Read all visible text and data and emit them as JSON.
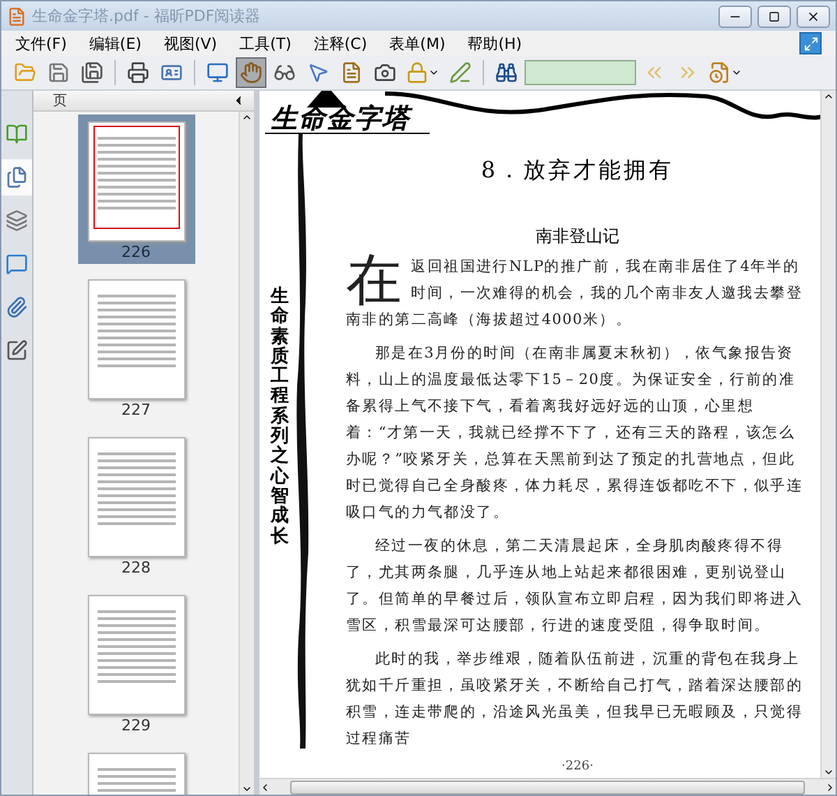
{
  "window": {
    "title": "生命金字塔.pdf - 福昕PDF阅读器"
  },
  "menu": [
    {
      "label": "文件(F)"
    },
    {
      "label": "编辑(E)"
    },
    {
      "label": "视图(V)"
    },
    {
      "label": "工具(T)"
    },
    {
      "label": "注释(C)"
    },
    {
      "label": "表单(M)"
    },
    {
      "label": "帮助(H)"
    }
  ],
  "toolbar": [
    [
      {
        "kind": "open",
        "selected": false
      },
      {
        "kind": "save",
        "selected": false
      },
      {
        "kind": "saveas",
        "selected": false
      }
    ],
    [
      {
        "kind": "print",
        "selected": false
      },
      {
        "kind": "card",
        "selected": false
      }
    ],
    [
      {
        "kind": "screen",
        "selected": false
      },
      {
        "kind": "hand",
        "selected": true
      },
      {
        "kind": "zoom",
        "selected": false
      },
      {
        "kind": "pointer",
        "selected": false
      },
      {
        "kind": "textselect",
        "selected": false
      },
      {
        "kind": "camera",
        "selected": false
      },
      {
        "kind": "lock",
        "selected": false
      },
      {
        "kind": "pen",
        "selected": false
      }
    ]
  ],
  "findbar": [
    {
      "kind": "binoculars"
    },
    {
      "kind": "field"
    },
    {
      "kind": "prev"
    },
    {
      "kind": "next"
    },
    {
      "kind": "filter"
    }
  ],
  "side_tabs": [
    {
      "kind": "bookmarks",
      "selected": false
    },
    {
      "kind": "pages",
      "selected": true
    },
    {
      "kind": "layers",
      "selected": false
    },
    {
      "kind": "comments",
      "selected": false
    },
    {
      "kind": "attachments",
      "selected": false
    },
    {
      "kind": "signature",
      "selected": false
    }
  ],
  "panel": {
    "title": "页",
    "thumbnails": [
      {
        "label": "226",
        "selected": true
      },
      {
        "label": "227",
        "selected": false
      },
      {
        "label": "228",
        "selected": false
      },
      {
        "label": "229",
        "selected": false
      },
      {
        "selected": false
      }
    ]
  },
  "document": {
    "logo": "生命金字塔",
    "side_text": "生命素质工程系列之心智成长",
    "title": "8．放弃才能拥有",
    "subtitle": "南非登山记",
    "drop_cap": "在",
    "paragraphs": [
      "返回祖国进行NLP的推广前，我在南非居住了4年半的时间，一次难得的机会，我的几个南非友人邀我去攀登南非的第二高峰（海拔超过4000米）。",
      "那是在3月份的时间（在南非属夏末秋初），依气象报告资料，山上的温度最低达零下15－20度。为保证安全，行前的准备累得上气不接下气，看着离我好远好远的山顶，心里想着：“才第一天，我就已经撑不下了，还有三天的路程，该怎么办呢？”咬紧牙关，总算在天黑前到达了预定的扎营地点，但此时已觉得自己全身酸疼，体力耗尽，累得连饭都吃不下，似乎连吸口气的力气都没了。",
      "经过一夜的休息，第二天清晨起床，全身肌肉酸疼得不得了，尤其两条腿，几乎连从地上站起来都很困难，更别说登山了。但简单的早餐过后，领队宣布立即启程，因为我们即将进入雪区，积雪最深可达腰部，行进的速度受阻，得争取时间。",
      "此时的我，举步维艰，随着队伍前进，沉重的背包在我身上犹如千斤重担，虽咬紧牙关，不断给自己打气，踏着深达腰部的积雪，连走带爬的，沿途风光虽美，但我早已无暇顾及，只觉得过程痛苦"
    ],
    "page_number": "·226·"
  }
}
